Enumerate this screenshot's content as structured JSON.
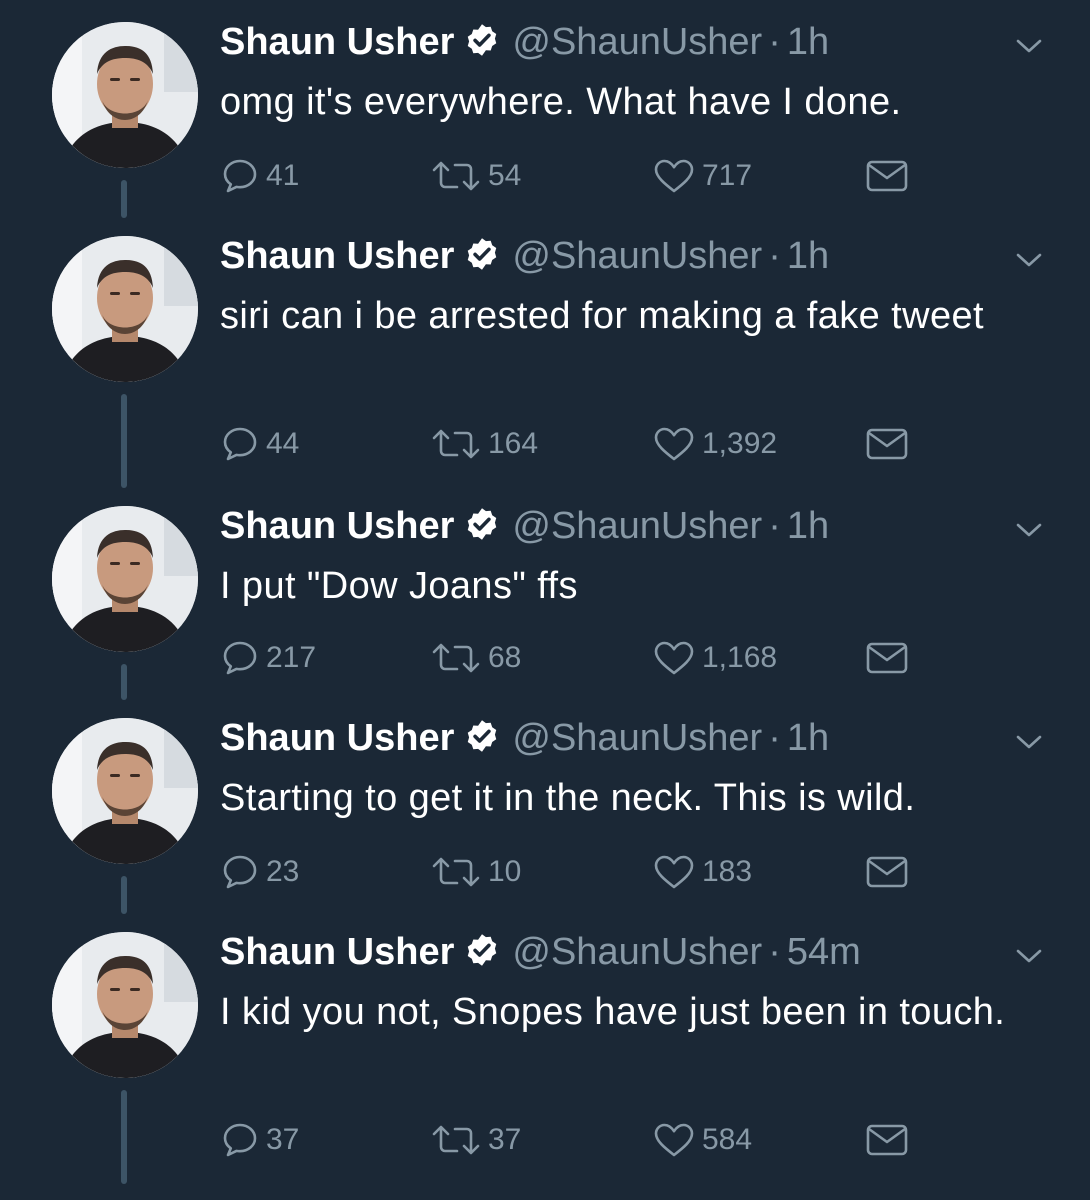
{
  "user": {
    "name": "Shaun Usher",
    "handle": "@ShaunUsher"
  },
  "separator": "·",
  "icons": {
    "verified": "verified-badge-icon",
    "caret": "chevron-down-icon",
    "reply": "reply-bubble-icon",
    "retweet": "retweet-arrows-icon",
    "like": "heart-icon",
    "dm": "envelope-icon"
  },
  "colors": {
    "background": "#1b2836",
    "muted": "#8899a6",
    "thread_line": "#3d5466"
  },
  "tweets": [
    {
      "time": "1h",
      "text": "omg it's everywhere. What have I done.",
      "replies": "41",
      "retweets": "54",
      "likes": "717"
    },
    {
      "time": "1h",
      "text": "siri can i be arrested for making a fake tweet",
      "replies": "44",
      "retweets": "164",
      "likes": "1,392"
    },
    {
      "time": "1h",
      "text": "I put \"Dow Joans\" ffs",
      "replies": "217",
      "retweets": "68",
      "likes": "1,168"
    },
    {
      "time": "1h",
      "text": "Starting to get it in the neck. This is wild.",
      "replies": "23",
      "retweets": "10",
      "likes": "183"
    },
    {
      "time": "54m",
      "text": "I kid you not, Snopes have just been in touch.",
      "replies": "37",
      "retweets": "37",
      "likes": "584"
    }
  ]
}
